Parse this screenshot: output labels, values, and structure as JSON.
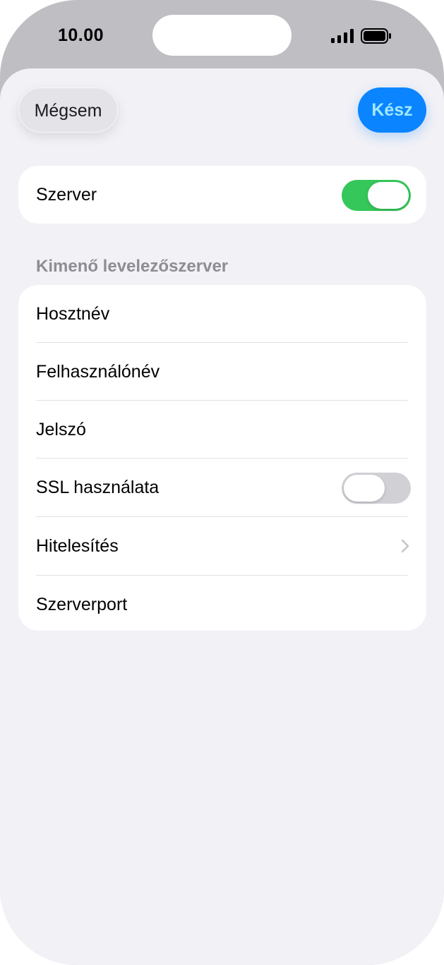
{
  "status_bar": {
    "time": "10.00",
    "icons": [
      "cellular-signal-icon",
      "battery-icon"
    ]
  },
  "navigation": {
    "cancel_label": "Mégsem",
    "done_label": "Kész",
    "done_color": "#0b84ff",
    "done_text_color": "#9fe8ff"
  },
  "server_card": {
    "label": "Szerver",
    "toggle_state": "on",
    "toggle_color": "#35c759"
  },
  "outgoing_section": {
    "header": "Kimenő levelezőszerver",
    "rows": [
      {
        "label": "Hosztnév",
        "accessory": "none"
      },
      {
        "label": "Felhasználónév",
        "accessory": "none"
      },
      {
        "label": "Jelszó",
        "accessory": "none"
      },
      {
        "label": "SSL használata",
        "accessory": "toggle",
        "toggle_state": "off"
      },
      {
        "label": "Hitelesítés",
        "accessory": "chevron-right-icon"
      },
      {
        "label": "Szerverport",
        "accessory": "none"
      }
    ]
  }
}
